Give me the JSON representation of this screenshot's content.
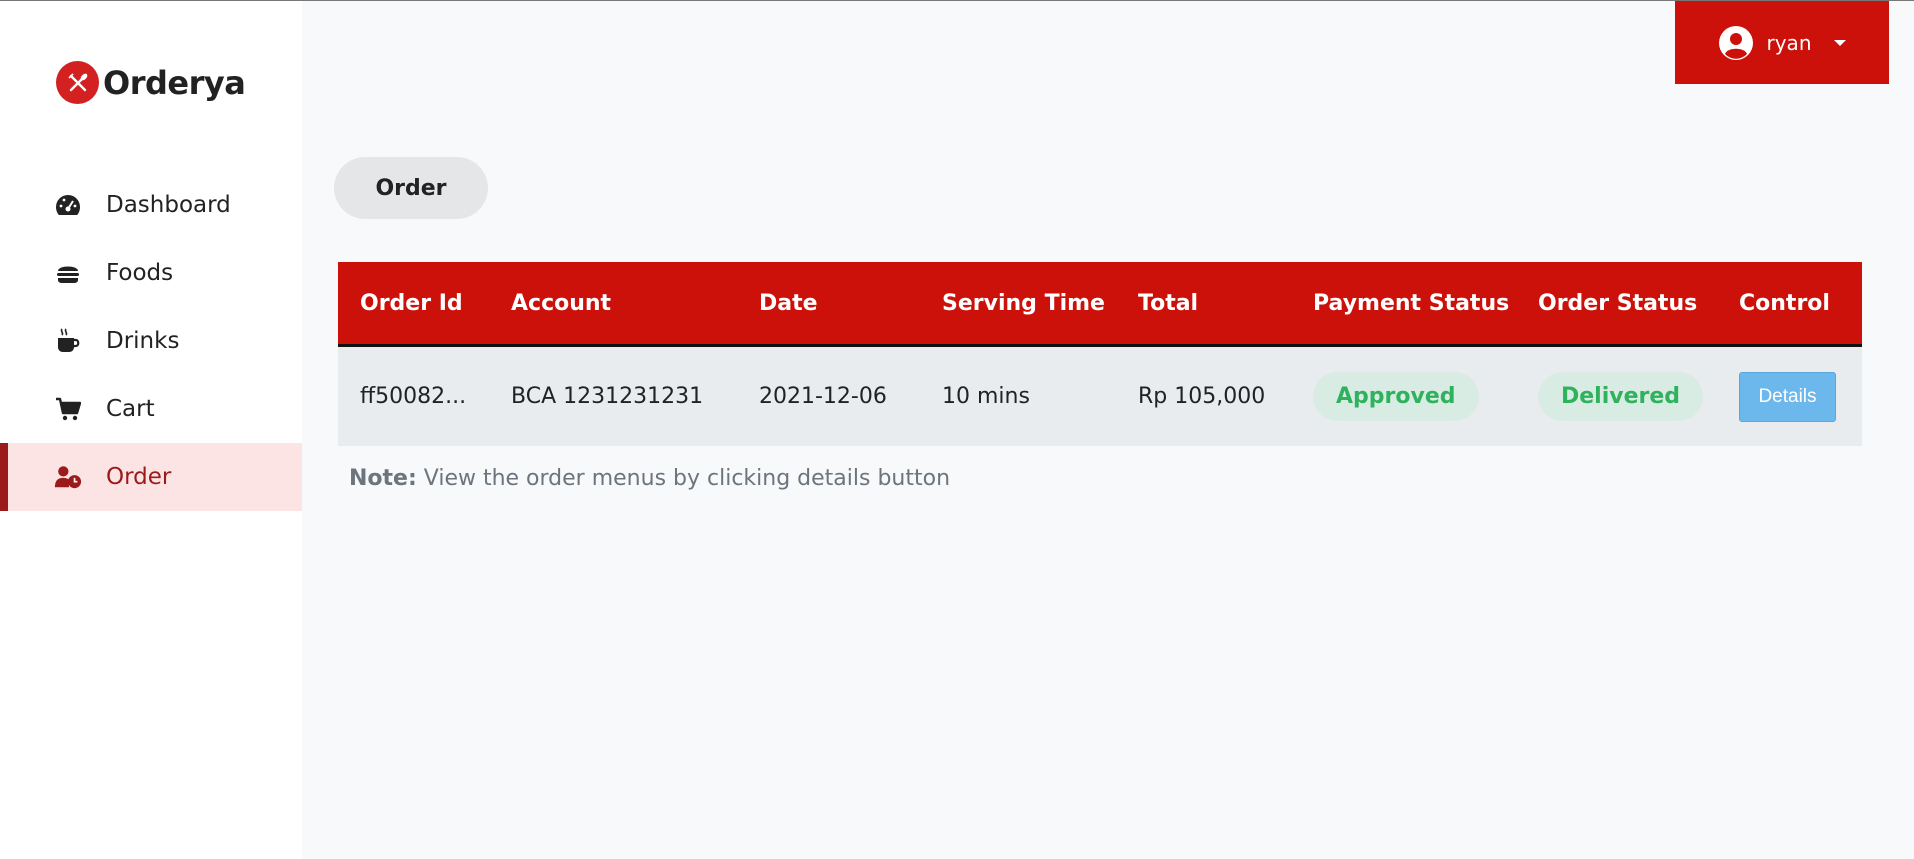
{
  "brand": {
    "name": "Orderya",
    "color": "#d32020"
  },
  "user": {
    "name": "ryan"
  },
  "sidebar": {
    "items": [
      {
        "label": "Dashboard",
        "icon": "gauge-icon"
      },
      {
        "label": "Foods",
        "icon": "burger-icon"
      },
      {
        "label": "Drinks",
        "icon": "mug-hot-icon"
      },
      {
        "label": "Cart",
        "icon": "cart-icon"
      },
      {
        "label": "Order",
        "icon": "user-clock-icon",
        "active": true
      }
    ]
  },
  "page": {
    "title": "Order"
  },
  "table": {
    "headers": [
      "Order Id",
      "Account",
      "Date",
      "Serving Time",
      "Total",
      "Payment Status",
      "Order Status",
      "Control"
    ],
    "rows": [
      {
        "order_id": "ff50082...",
        "account": "BCA 1231231231",
        "date": "2021-12-06",
        "serving_time": "10 mins",
        "total": "Rp 105,000",
        "payment_status": "Approved",
        "order_status": "Delivered",
        "control": "Details"
      }
    ]
  },
  "note": {
    "label": "Note:",
    "text": " View the order menus by clicking details button"
  },
  "colors": {
    "accent": "#cc110a",
    "active_bg": "#fce4e4",
    "active_text": "#9b1b1b",
    "badge_text": "#2fb25d",
    "details_button": "#6cb8ec"
  }
}
